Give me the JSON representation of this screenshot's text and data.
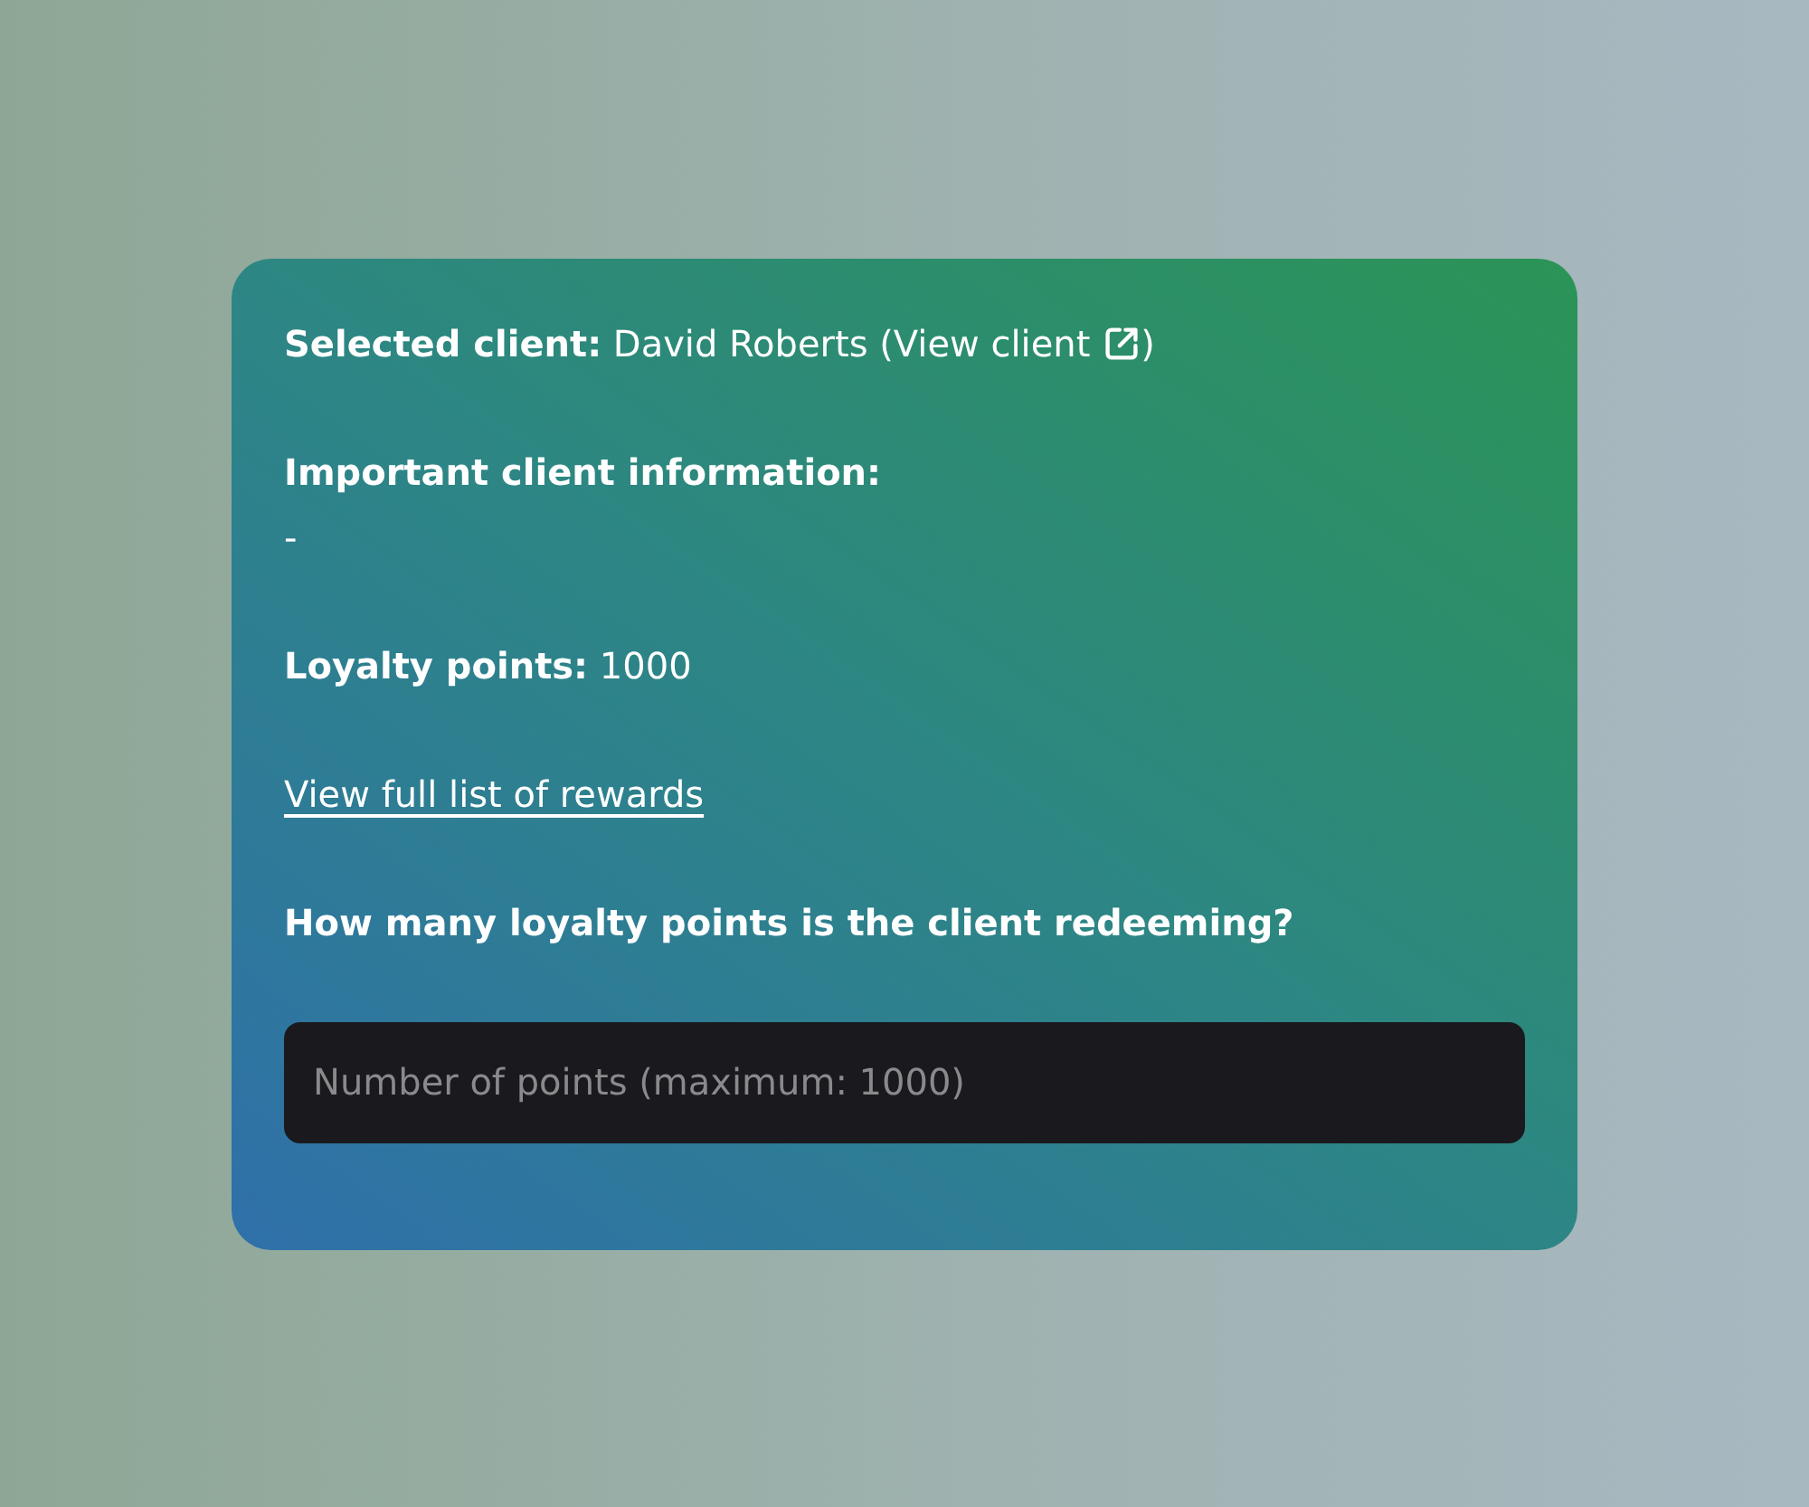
{
  "selected_client": {
    "text_before": "**Selected client:** David Roberts (",
    "link": "View client",
    "text_after": ")"
  },
  "important_info": {
    "label": "Important client information:",
    "value": "-"
  },
  "loyalty_points": {
    "text": "**Loyalty points:** 1000"
  },
  "rewards_link": {
    "text": "View full list of rewards"
  },
  "redeem": {
    "question": "How many loyalty points is the client redeeming?",
    "input": {
      "placeholder": "Number of points (maximum: 1000)"
    }
  }
}
